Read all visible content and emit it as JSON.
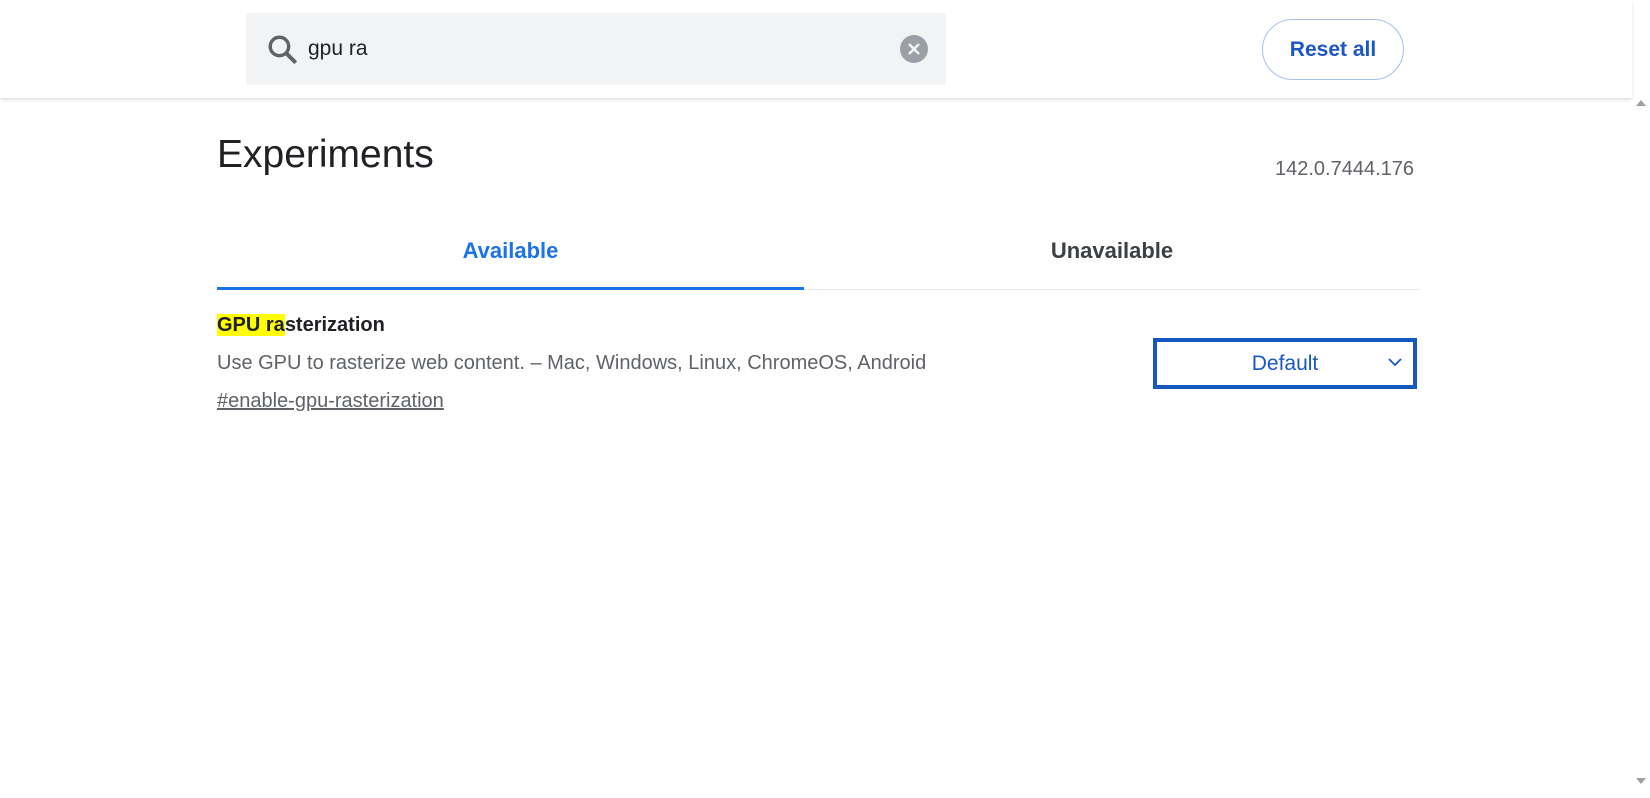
{
  "header": {
    "search": {
      "value": "gpu ra",
      "placeholder": "Search flags"
    },
    "reset_label": "Reset all"
  },
  "page": {
    "title": "Experiments",
    "version": "142.0.7444.176"
  },
  "tabs": [
    {
      "label": "Available",
      "active": true
    },
    {
      "label": "Unavailable",
      "active": false
    }
  ],
  "experiments": [
    {
      "name_highlight": "GPU ra",
      "name_rest": "sterization",
      "description": "Use GPU to rasterize web content. – Mac, Windows, Linux, ChromeOS, Android",
      "link": "#enable-gpu-rasterization",
      "selected": "Default"
    }
  ],
  "colors": {
    "accent": "#1a73e8",
    "highlight": "#ffff00",
    "select_border": "#1558c0"
  }
}
